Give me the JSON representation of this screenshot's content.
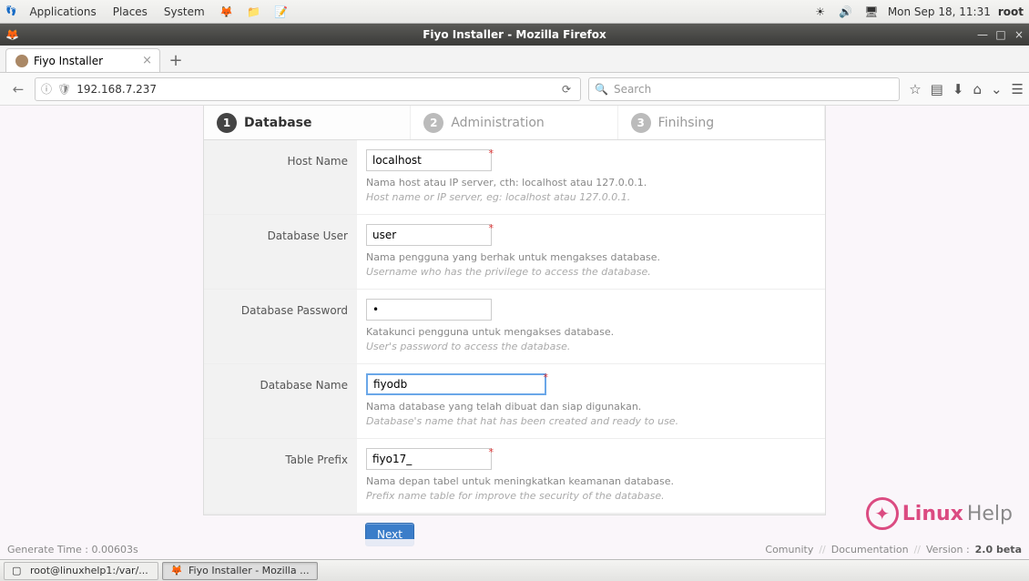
{
  "panel": {
    "apps": "Applications",
    "places": "Places",
    "system": "System",
    "clock": "Mon Sep 18, 11:31",
    "user": "root"
  },
  "window": {
    "title": "Fiyo Installer - Mozilla Firefox"
  },
  "tab": {
    "title": "Fiyo Installer"
  },
  "nav": {
    "url": "192.168.7.237",
    "search_placeholder": "Search"
  },
  "steps": {
    "s1": "Database",
    "s2": "Administration",
    "s3": "Finihsing"
  },
  "form": {
    "host": {
      "label": "Host Name",
      "value": "localhost",
      "hint1": "Nama host atau IP server, cth: localhost atau 127.0.0.1.",
      "hint2": "Host name or IP server, eg: localhost atau 127.0.0.1."
    },
    "user": {
      "label": "Database User",
      "value": "user",
      "hint1": "Nama pengguna yang berhak untuk mengakses database.",
      "hint2": "Username who has the privilege to access the database."
    },
    "pass": {
      "label": "Database Password",
      "value": "•",
      "hint1": "Katakunci pengguna untuk mengakses database.",
      "hint2": "User's password to access the database."
    },
    "name": {
      "label": "Database Name",
      "value": "fiyodb",
      "hint1": "Nama database yang telah dibuat dan siap digunakan.",
      "hint2": "Database's name that hat has been created and ready to use."
    },
    "prefix": {
      "label": "Table Prefix",
      "value": "fiyo17_",
      "hint1": "Nama depan tabel untuk meningkatkan keamanan database.",
      "hint2": "Prefix name table for improve the security of the database."
    }
  },
  "next_label": "Next",
  "footer": {
    "gen": "Generate Time : 0.00603s",
    "links": [
      "Comunity",
      "Documentation"
    ],
    "version_label": "Version :",
    "version": "2.0 beta"
  },
  "watermark": {
    "brand": "Linux",
    "suffix": "Help"
  },
  "taskbar": {
    "t1": "root@linuxhelp1:/var/...",
    "t2": "Fiyo Installer - Mozilla ..."
  }
}
